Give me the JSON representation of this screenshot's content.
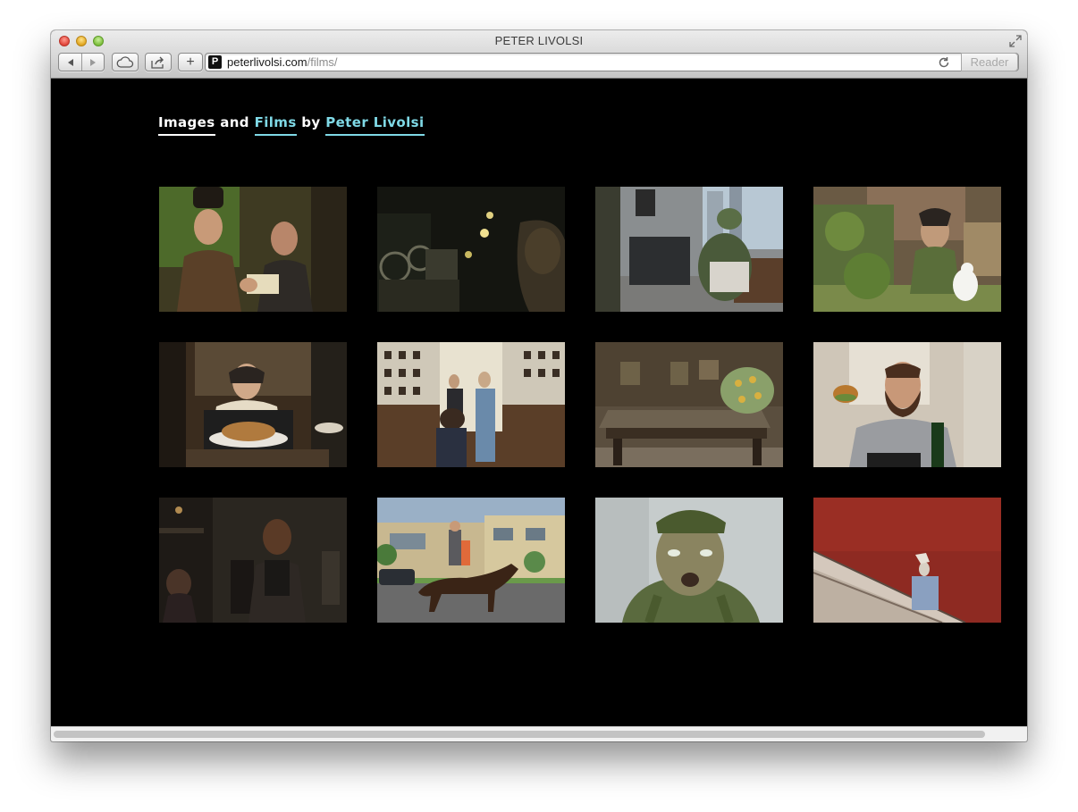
{
  "window": {
    "title": "PETER LIVOLSI"
  },
  "toolbar": {
    "address_domain": "peterlivolsi.com",
    "address_path": "/films/",
    "favicon_letter": "P",
    "reader_label": "Reader",
    "add_label": "+"
  },
  "site": {
    "title_images": "Images",
    "title_and": " and ",
    "title_films": "Films",
    "title_by": " by ",
    "title_name": "Peter Livolsi"
  },
  "colors": {
    "accent_cyan": "#7fd9e6",
    "background": "#000000"
  },
  "thumbnails": [
    {
      "scene": "two-men-business-card"
    },
    {
      "scene": "film-projector-dark-room"
    },
    {
      "scene": "turtle-creature-office"
    },
    {
      "scene": "gnome-figure-garden-with-bird"
    },
    {
      "scene": "woman-serving-roast-turkey"
    },
    {
      "scene": "hallway-handshake-frames"
    },
    {
      "scene": "billiard-table-green-creature"
    },
    {
      "scene": "bearded-man-eating-burger"
    },
    {
      "scene": "man-in-dark-room-sitting"
    },
    {
      "scene": "riders-on-horse-street"
    },
    {
      "scene": "soldier-closeup-green-face"
    },
    {
      "scene": "escalator-red-wall"
    }
  ]
}
